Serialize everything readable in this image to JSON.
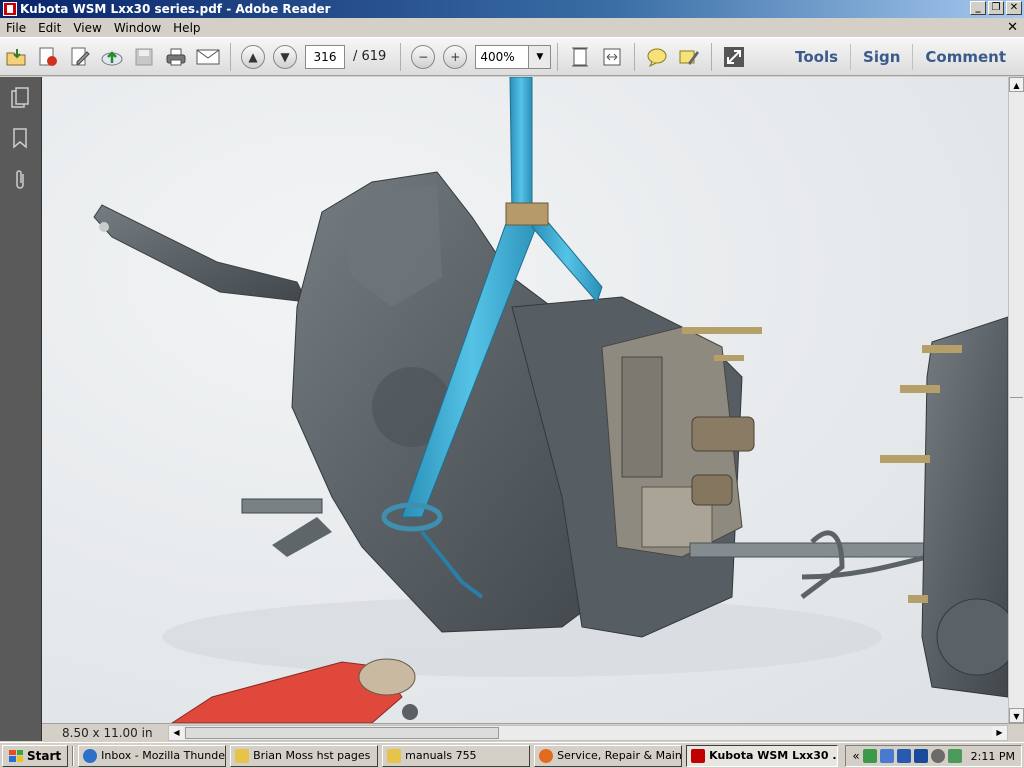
{
  "window": {
    "title": "Kubota WSM Lxx30 series.pdf - Adobe Reader",
    "minimize_glyph": "_",
    "restore_glyph": "❐",
    "close_glyph": "✕"
  },
  "menu": {
    "items": [
      "File",
      "Edit",
      "View",
      "Window",
      "Help"
    ],
    "close_glyph": "✕"
  },
  "toolbar": {
    "current_page": "316",
    "page_total": "/ 619",
    "zoom": "400%",
    "zoom_dropdown_glyph": "▼",
    "links": [
      "Tools",
      "Sign",
      "Comment"
    ],
    "icons": [
      "open-icon",
      "create-pdf-icon",
      "edit-icon",
      "upload-icon",
      "save-icon",
      "print-icon",
      "email-icon",
      "prev-page-icon",
      "next-page-icon",
      "zoom-out-icon",
      "zoom-in-icon",
      "fit-page-icon",
      "fit-width-icon",
      "comment-icon",
      "highlight-icon",
      "fullscreen-icon"
    ]
  },
  "document": {
    "page_size": "8.50 x 11.00 in"
  },
  "taskbar": {
    "start_label": "Start",
    "tasks": [
      {
        "label": "Inbox - Mozilla Thunde...",
        "active": false,
        "color": "#2e6fc7"
      },
      {
        "label": "Brian Moss hst pages",
        "active": false,
        "color": "#e8c34a"
      },
      {
        "label": "manuals 755",
        "active": false,
        "color": "#e8c34a"
      },
      {
        "label": "Service, Repair & Main...",
        "active": false,
        "color": "#e26a1c"
      },
      {
        "label": "Kubota WSM Lxx30 ...",
        "active": true,
        "color": "#c00000"
      }
    ],
    "tray_expand": "«",
    "clock": "2:11 PM"
  },
  "colors": {
    "titlebar_start": "#0a246a",
    "strap": "#3fb0d8",
    "housing": "#5b6267",
    "toolbar_links": "#3a5a8c"
  }
}
